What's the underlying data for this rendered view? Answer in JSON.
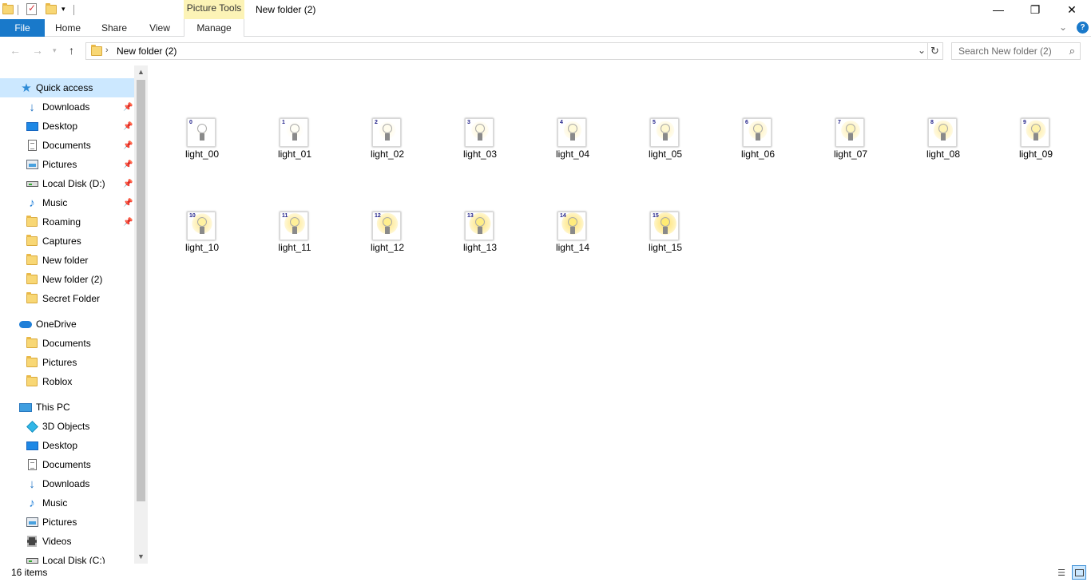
{
  "window": {
    "title": "New folder (2)",
    "context_tab": "Picture Tools"
  },
  "ribbon": {
    "tabs": [
      "File",
      "Home",
      "Share",
      "View",
      "Manage"
    ]
  },
  "address": {
    "path": "New folder (2)",
    "search_placeholder": "Search New folder (2)"
  },
  "sidebar": {
    "quick_access": {
      "label": "Quick access",
      "items": [
        {
          "label": "Downloads",
          "icon": "downloads-icon",
          "pinned": true
        },
        {
          "label": "Desktop",
          "icon": "desktop-icon",
          "pinned": true
        },
        {
          "label": "Documents",
          "icon": "documents-icon",
          "pinned": true
        },
        {
          "label": "Pictures",
          "icon": "pictures-icon",
          "pinned": true
        },
        {
          "label": "Local Disk (D:)",
          "icon": "drive-icon",
          "pinned": true
        },
        {
          "label": "Music",
          "icon": "music-icon",
          "pinned": true
        },
        {
          "label": "Roaming",
          "icon": "folder-icon",
          "pinned": true
        },
        {
          "label": "Captures",
          "icon": "folder-icon",
          "pinned": false
        },
        {
          "label": "New folder",
          "icon": "folder-icon",
          "pinned": false
        },
        {
          "label": "New folder (2)",
          "icon": "folder-icon",
          "pinned": false
        },
        {
          "label": "Secret Folder",
          "icon": "folder-icon",
          "pinned": false
        }
      ]
    },
    "onedrive": {
      "label": "OneDrive",
      "items": [
        {
          "label": "Documents",
          "icon": "folder-icon"
        },
        {
          "label": "Pictures",
          "icon": "folder-icon"
        },
        {
          "label": "Roblox",
          "icon": "folder-icon"
        }
      ]
    },
    "this_pc": {
      "label": "This PC",
      "items": [
        {
          "label": "3D Objects",
          "icon": "3d-objects-icon"
        },
        {
          "label": "Desktop",
          "icon": "desktop-icon"
        },
        {
          "label": "Documents",
          "icon": "documents-icon"
        },
        {
          "label": "Downloads",
          "icon": "downloads-icon"
        },
        {
          "label": "Music",
          "icon": "music-icon"
        },
        {
          "label": "Pictures",
          "icon": "pictures-icon"
        },
        {
          "label": "Videos",
          "icon": "videos-icon"
        },
        {
          "label": "Local Disk (C:)",
          "icon": "drive-icon"
        }
      ]
    }
  },
  "files": [
    {
      "name": "light_00",
      "num": "0",
      "brightness": 0.0
    },
    {
      "name": "light_01",
      "num": "1",
      "brightness": 0.07
    },
    {
      "name": "light_02",
      "num": "2",
      "brightness": 0.13
    },
    {
      "name": "light_03",
      "num": "3",
      "brightness": 0.2
    },
    {
      "name": "light_04",
      "num": "4",
      "brightness": 0.27
    },
    {
      "name": "light_05",
      "num": "5",
      "brightness": 0.33
    },
    {
      "name": "light_06",
      "num": "6",
      "brightness": 0.4
    },
    {
      "name": "light_07",
      "num": "7",
      "brightness": 0.47
    },
    {
      "name": "light_08",
      "num": "8",
      "brightness": 0.53
    },
    {
      "name": "light_09",
      "num": "9",
      "brightness": 0.6
    },
    {
      "name": "light_10",
      "num": "10",
      "brightness": 0.67
    },
    {
      "name": "light_11",
      "num": "11",
      "brightness": 0.73
    },
    {
      "name": "light_12",
      "num": "12",
      "brightness": 0.8
    },
    {
      "name": "light_13",
      "num": "13",
      "brightness": 0.87
    },
    {
      "name": "light_14",
      "num": "14",
      "brightness": 0.93
    },
    {
      "name": "light_15",
      "num": "15",
      "brightness": 1.0
    }
  ],
  "status": {
    "count": "16 items"
  },
  "colors": {
    "accent": "#1979ca",
    "selection": "#cce8ff",
    "folder": "#f8d775",
    "context_tab": "#fcf3b6"
  }
}
